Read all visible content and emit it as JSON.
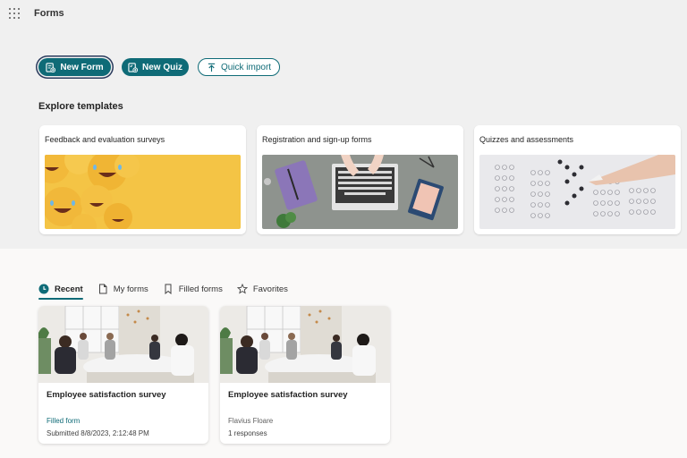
{
  "app": {
    "title": "Forms"
  },
  "actions": {
    "new_form": "New Form",
    "new_quiz": "New Quiz",
    "quick_import": "Quick import"
  },
  "templates": {
    "heading": "Explore templates",
    "items": [
      {
        "label": "Feedback and evaluation surveys",
        "image": "emoji-laughing-faces"
      },
      {
        "label": "Registration and sign-up forms",
        "image": "laptop-desk-notebooks"
      },
      {
        "label": "Quizzes and assessments",
        "image": "bubble-answer-sheet"
      }
    ]
  },
  "tabs": [
    {
      "label": "Recent",
      "icon": "clock-icon",
      "active": true
    },
    {
      "label": "My forms",
      "icon": "document-icon",
      "active": false
    },
    {
      "label": "Filled forms",
      "icon": "bookmark-icon",
      "active": false
    },
    {
      "label": "Favorites",
      "icon": "star-icon",
      "active": false
    }
  ],
  "forms": [
    {
      "title": "Employee satisfaction survey",
      "subtitle": "Filled form",
      "meta": "Submitted 8/8/2023, 2:12:48 PM",
      "image": "office-meeting-photo"
    },
    {
      "title": "Employee satisfaction survey",
      "subtitle": "Flavius Floare",
      "meta": "1 responses",
      "image": "office-meeting-photo"
    }
  ],
  "colors": {
    "accent": "#0f6b77",
    "header_bg": "#f0f0f0",
    "page_bg": "#faf9f8"
  }
}
